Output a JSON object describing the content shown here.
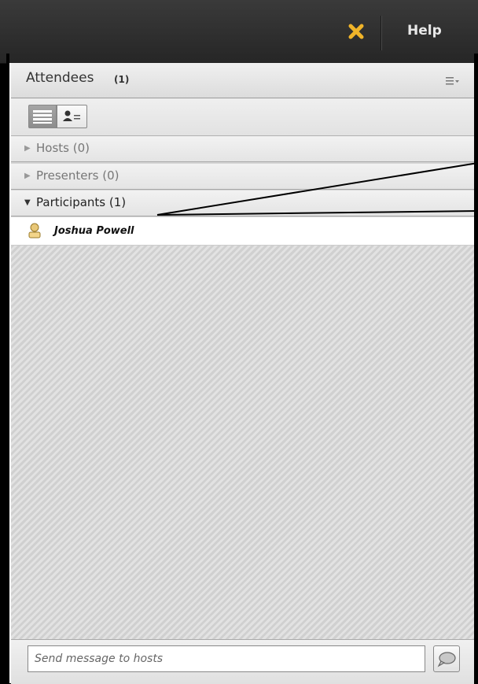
{
  "topbar": {
    "close_icon": "close-x-icon",
    "help_label": "Help",
    "accent": "#f0b429"
  },
  "attendees": {
    "title": "Attendees",
    "count": "(1)",
    "menu_icon": "list-menu-icon",
    "views": [
      "list-view-icon",
      "attendee-card-view-icon"
    ],
    "sections": [
      {
        "label": "Hosts (0)",
        "expanded": false
      },
      {
        "label": "Presenters (0)",
        "expanded": false
      },
      {
        "label": "Participants (1)",
        "expanded": true
      }
    ],
    "participants": [
      {
        "name": "Joshua Powell",
        "icon": "person-icon"
      }
    ]
  },
  "footer": {
    "message_placeholder": "Send message to hosts",
    "send_icon": "speech-bubble-icon"
  }
}
